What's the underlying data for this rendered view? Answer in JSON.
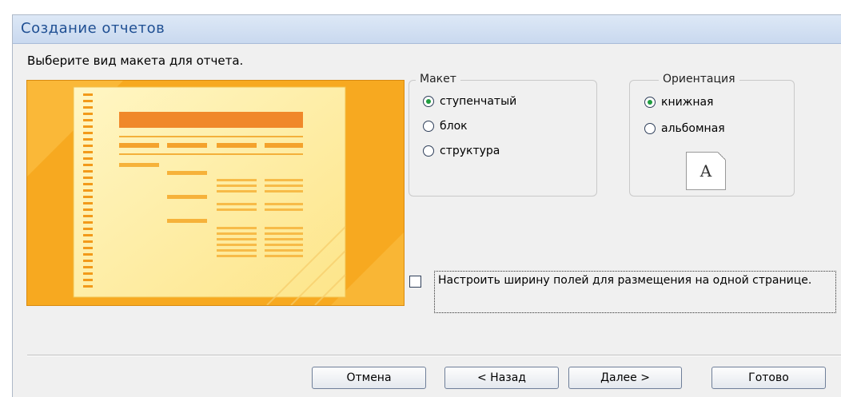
{
  "window": {
    "title": "Создание отчетов"
  },
  "prompt": "Выберите вид макета для отчета.",
  "layout_group": {
    "label": "Макет",
    "options": [
      {
        "label": "ступенчатый",
        "checked": true
      },
      {
        "label": "блок",
        "checked": false
      },
      {
        "label": "структура",
        "checked": false
      }
    ]
  },
  "orientation_group": {
    "label": "Ориентация",
    "options": [
      {
        "label": "книжная",
        "checked": true
      },
      {
        "label": "альбомная",
        "checked": false
      }
    ],
    "icon_letter": "A"
  },
  "fit_checkbox": {
    "label": "Настроить ширину полей для размещения на одной странице.",
    "checked": false
  },
  "buttons": {
    "cancel": "Отмена",
    "back": "< Назад",
    "next": "Далее >",
    "finish": "Готово"
  },
  "colors": {
    "preview_accent": "#f7a920",
    "title_text": "#1f4f93",
    "radio_selected": "#1f9d3f"
  }
}
